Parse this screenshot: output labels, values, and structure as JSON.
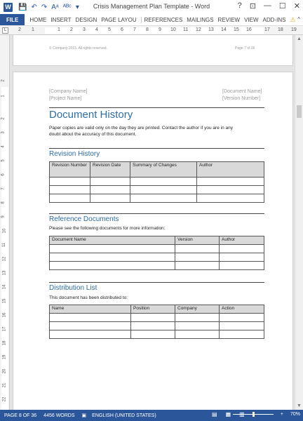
{
  "window": {
    "title": "Crisis Management Plan Template - Word",
    "help": "?",
    "controls": [
      "⊡",
      "—",
      "☐",
      "✕"
    ]
  },
  "qat": [
    "💾",
    "↶",
    "↷",
    "Aᵃ",
    "ᴬᴮᶜ",
    "▾"
  ],
  "ribbon": {
    "file": "FILE",
    "tabs": [
      "HOME",
      "INSERT",
      "DESIGN",
      "PAGE LAYOU",
      "REFERENCES",
      "MAILINGS",
      "REVIEW",
      "VIEW",
      "ADD-INS"
    ],
    "right": [
      "^"
    ]
  },
  "ruler": {
    "tab_selector": "L",
    "h_ticks": [
      "2",
      "1",
      "1",
      "2",
      "3",
      "4",
      "5",
      "6",
      "7",
      "8",
      "9",
      "10",
      "11",
      "12",
      "13",
      "14",
      "15",
      "16",
      "17",
      "18",
      "19"
    ],
    "v_ticks": [
      "2",
      "1",
      "2",
      "3",
      "4",
      "5",
      "6",
      "7",
      "8",
      "9",
      "10",
      "11",
      "12",
      "13",
      "14",
      "15",
      "16",
      "17",
      "18",
      "19",
      "20",
      "21",
      "22"
    ]
  },
  "prev_page": {
    "footer_left": "© Company 2015. All rights reserved.",
    "footer_right": "Page 7 of 36"
  },
  "page": {
    "company": "[Company Name]",
    "project": "[Project Name]",
    "doc_name": "[Document Name]",
    "version": "[Version Number]",
    "heading": "Document History",
    "intro_line1": "Paper copies are valid only on the day they are printed. Contact the author if you are in any",
    "intro_line2": "doubt about the accuracy of this document.",
    "revision": {
      "title": "Revision History",
      "headers": [
        "Revision Number",
        "Revision Date",
        "Summary of Changes",
        "Author"
      ]
    },
    "reference": {
      "title": "Reference Documents",
      "text": "Please see the following documents for more information:",
      "headers": [
        "Document Name",
        "Version",
        "Author"
      ]
    },
    "distribution": {
      "title": "Distribution List",
      "text": "This document has been distributed to:",
      "headers": [
        "Name",
        "Position",
        "Company",
        "Action"
      ]
    }
  },
  "status": {
    "page": "PAGE 8 OF 36",
    "words": "4456 WORDS",
    "language": "ENGLISH (UNITED STATES)",
    "zoom_out": "−",
    "zoom_in": "+",
    "zoom": "70%"
  },
  "colors": {
    "accent": "#2b579a",
    "heading": "#2e6da4"
  }
}
